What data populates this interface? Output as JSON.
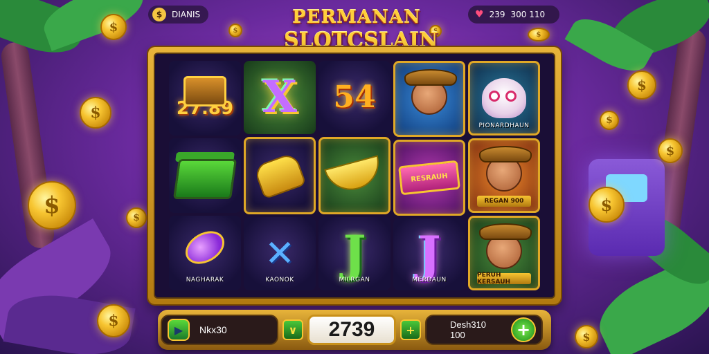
{
  "header": {
    "title_line1": "PERMANAN",
    "title_line2": "SLOTCSLAIN",
    "left_badge": "DIANIS",
    "right_badge_a": "239",
    "right_badge_b": "300 110"
  },
  "reels": {
    "col1": {
      "value": "27.89",
      "label": "NAGHARAK"
    },
    "col2": {
      "label": "KAONOK"
    },
    "col3": {
      "symbol_top": "54",
      "label": "MILRGAN"
    },
    "col4": {
      "sign_text": "RESRAUH",
      "label": "MERDAUN"
    },
    "col5": {
      "label_top": "PIONARDHAUN",
      "label_mid": "REGAN 900",
      "label_bottom": "PERUH KERSAUH"
    }
  },
  "symbols": {
    "x": "X",
    "j": "J"
  },
  "controls": {
    "left_text": "Nkx30",
    "bet_value": "2739",
    "minus_symbol": "∨",
    "plus_symbol": "+",
    "right_text_1": "Desh310",
    "right_text_2": "100",
    "big_plus_symbol": "+"
  },
  "colors": {
    "gold": "#f7c531",
    "purple_bg": "#6a2a9e",
    "green_button": "#4ac83a"
  }
}
